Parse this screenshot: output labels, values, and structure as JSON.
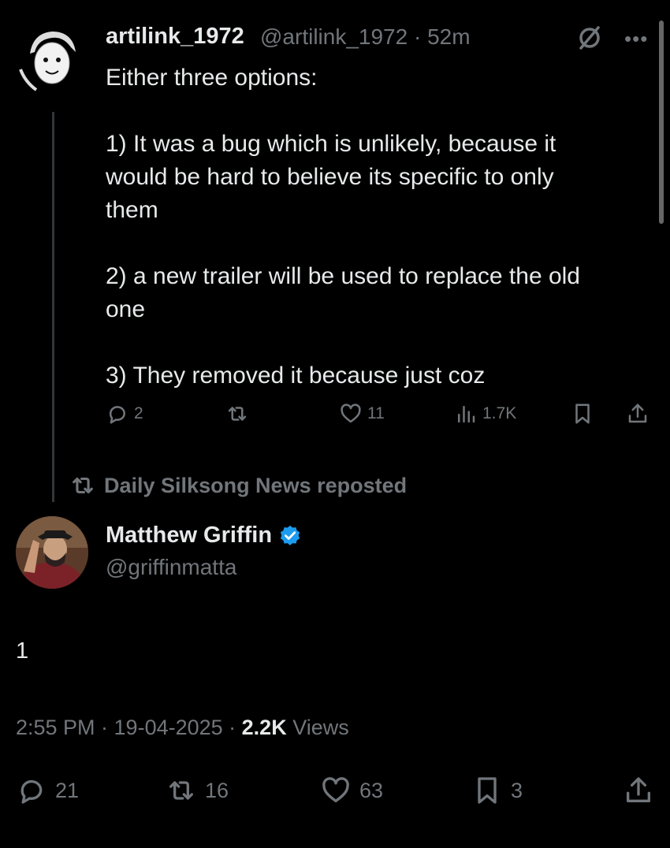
{
  "post1": {
    "display_name": "artilink_1972",
    "handle_time": "@artilink_1972 · 52m",
    "lines": [
      "Either three options:",
      "1) It was a bug which is unlikely, because it",
      "would be hard to believe its specific to only",
      "them",
      "2) a new trailer will be used to replace the old",
      "one",
      "3) They removed it because just coz"
    ],
    "actions": {
      "reply_count": "2",
      "like_count": "11",
      "views_count": "1.7K"
    }
  },
  "repost": {
    "label": "Daily Silksong News reposted"
  },
  "post2": {
    "display_name": "Matthew Griffin",
    "handle": "@griffinmatta",
    "body": "1",
    "time": "2:55 PM · 19-04-2025 · ",
    "views_count": "2.2K",
    "views_label": " Views",
    "actions": {
      "reply_count": "21",
      "repost_count": "16",
      "like_count": "63",
      "bookmark_count": "3"
    }
  },
  "icons": [
    "grok-icon",
    "more-icon",
    "reply-icon",
    "repost-icon",
    "like-icon",
    "views-icon",
    "bookmark-icon",
    "share-icon",
    "verified-badge-icon"
  ],
  "colors": {
    "background": "#000000",
    "text": "#e7e9ea",
    "muted": "#71767b",
    "verified": "#1d9bf0"
  }
}
